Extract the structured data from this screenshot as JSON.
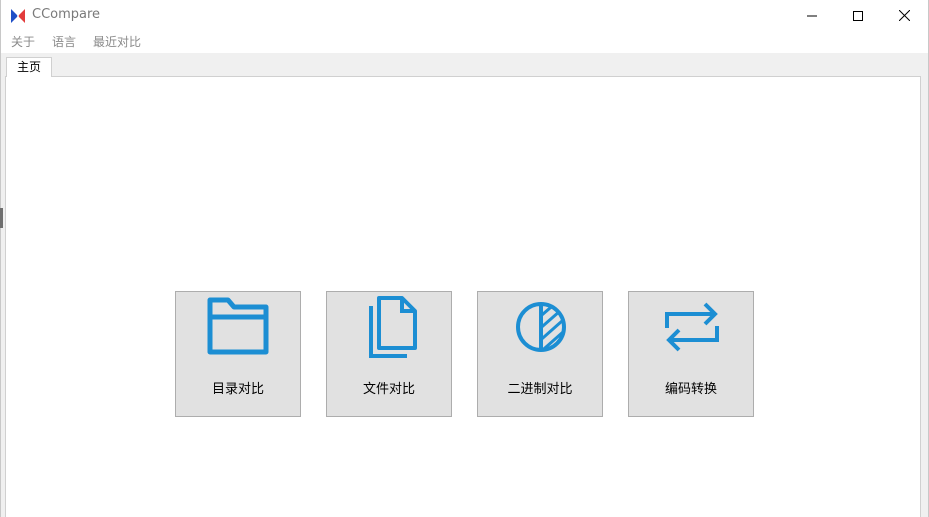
{
  "window": {
    "title": "CCompare",
    "controls": {
      "minimize": "minimize-icon",
      "maximize": "maximize-icon",
      "close": "close-icon"
    }
  },
  "menu": {
    "items": [
      "关于",
      "语言",
      "最近对比"
    ]
  },
  "tabs": [
    {
      "label": "主页",
      "active": true
    }
  ],
  "main": {
    "tiles": [
      {
        "label": "目录对比",
        "icon": "folder-icon"
      },
      {
        "label": "文件对比",
        "icon": "files-icon"
      },
      {
        "label": "二进制对比",
        "icon": "binary-pie-icon"
      },
      {
        "label": "编码转换",
        "icon": "convert-arrows-icon"
      }
    ]
  },
  "colors": {
    "accent": "#1c8ed3",
    "tile_bg": "#e1e1e1",
    "tile_border": "#adadad",
    "menu_text": "#8a8a8a",
    "logo_red": "#e23c3c",
    "logo_blue": "#1f4fc7"
  }
}
